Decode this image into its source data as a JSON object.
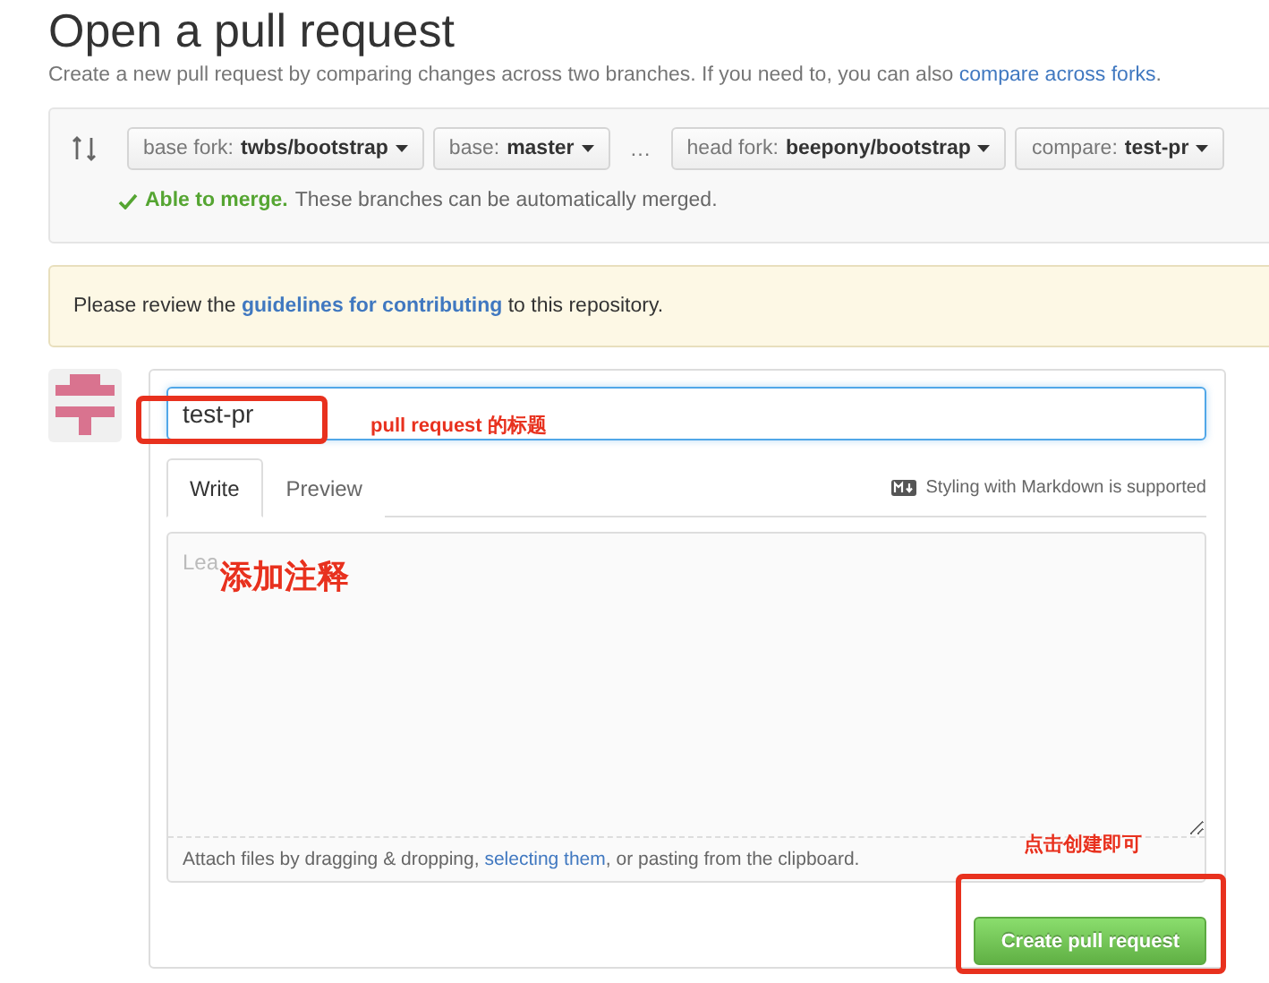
{
  "header": {
    "title": "Open a pull request",
    "description": {
      "before": "Create a new pull request by comparing changes across two branches. If you need to, you can also ",
      "link": "compare across forks",
      "after": "."
    }
  },
  "compare": {
    "selectors": [
      {
        "label": "base fork:",
        "value": "twbs/bootstrap"
      },
      {
        "label": "base:",
        "value": "master"
      },
      {
        "kind": "separator",
        "text": "…"
      },
      {
        "label": "head fork:",
        "value": "beepony/bootstrap"
      },
      {
        "label": "compare:",
        "value": "test-pr"
      }
    ],
    "merge": {
      "mergeable": true,
      "headline": "Able to merge.",
      "text": "These branches can be automatically merged."
    }
  },
  "notice": {
    "before": "Please review the ",
    "link": "guidelines for contributing",
    "after": " to this repository."
  },
  "form": {
    "title_value": "test-pr",
    "tabs": [
      {
        "label": "Write",
        "selected": true
      },
      {
        "label": "Preview",
        "selected": false
      }
    ],
    "markdown_hint": "Styling with Markdown is supported",
    "comment_placeholder": "Lea",
    "attach": {
      "before": "Attach files by dragging & dropping, ",
      "link": "selecting them",
      "after": ", or pasting from the clipboard."
    },
    "submit": "Create pull request"
  },
  "annotations": {
    "title_note": "pull request 的标题",
    "comment_note": "添加注释",
    "submit_note": "点击创建即可"
  }
}
